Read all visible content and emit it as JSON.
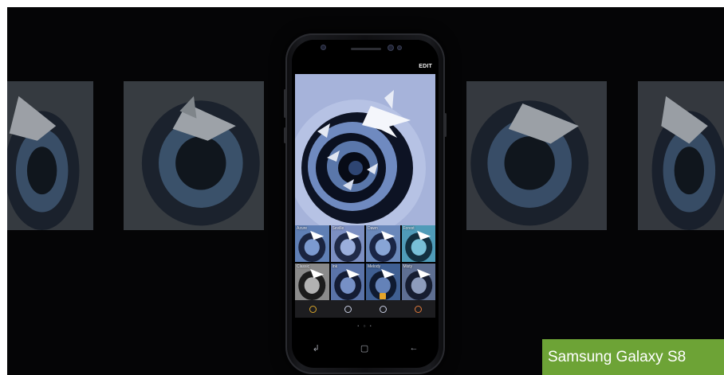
{
  "phone": {
    "edit_label": "EDIT",
    "filters": [
      {
        "label": "Azure"
      },
      {
        "label": "Seville"
      },
      {
        "label": "Dawn"
      },
      {
        "label": "Forest"
      },
      {
        "label": "Classic"
      },
      {
        "label": "Ink"
      },
      {
        "label": "Melody"
      },
      {
        "label": "Misty"
      }
    ],
    "selected_filter_index": 6,
    "tools": [
      {
        "icon": "square-tool-icon",
        "color": "#d9a62b"
      },
      {
        "icon": "sticker-tool-icon",
        "color": "#c9cfe3"
      },
      {
        "icon": "person-tool-icon",
        "color": "#c9cfe3"
      },
      {
        "icon": "grid-tool-icon",
        "color": "#e07a3c"
      }
    ],
    "pager": "• ○ •",
    "nav": {
      "recent": "↲",
      "home": "▢",
      "back": "←"
    }
  },
  "caption": "Samsung Galaxy S8",
  "accent_color": "#6da336"
}
